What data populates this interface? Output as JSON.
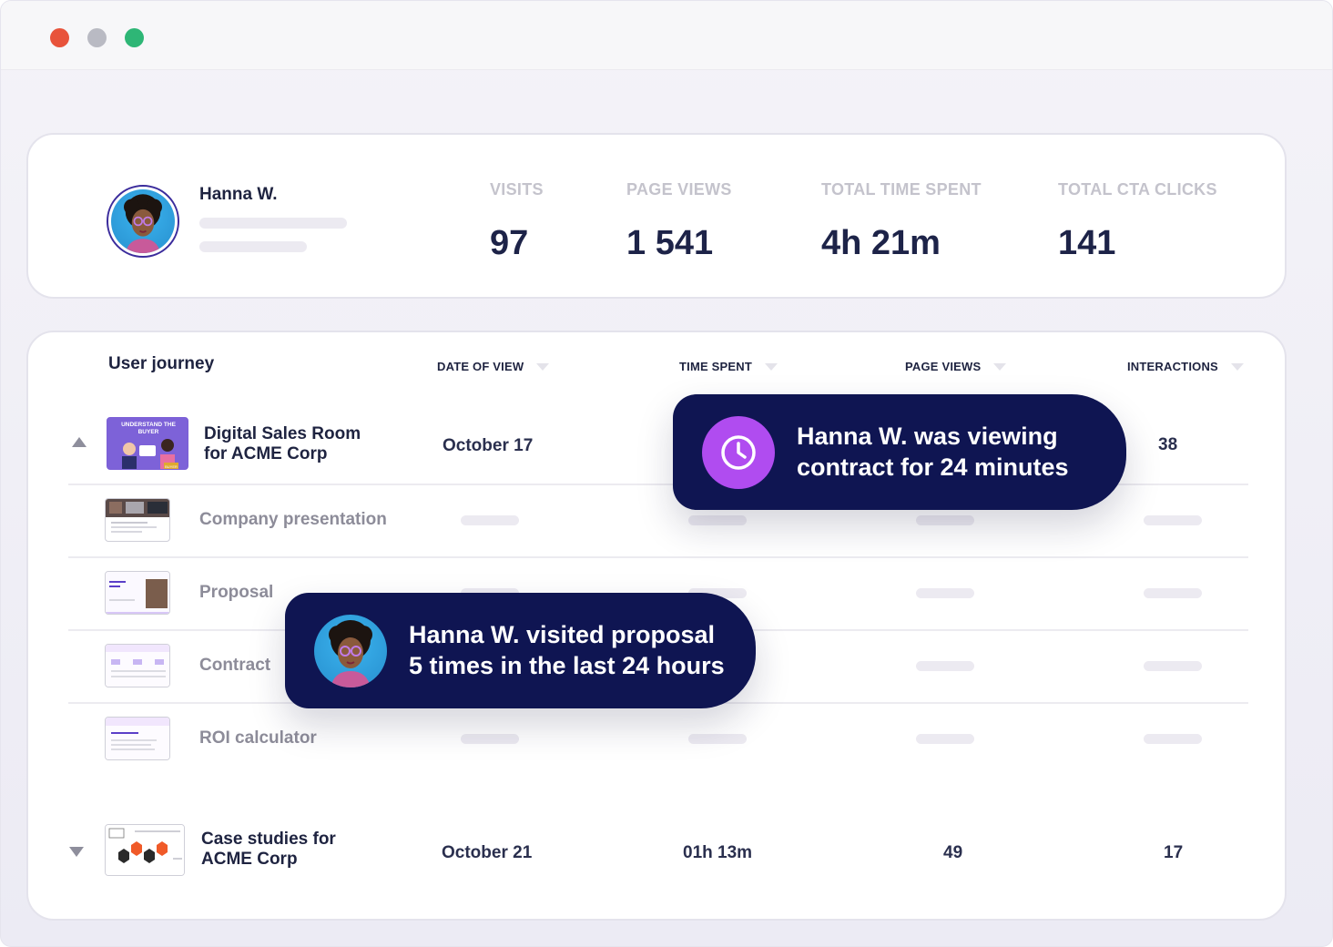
{
  "profile": {
    "name": "Hanna W.",
    "stats": [
      {
        "label": "VISITS",
        "value": "97"
      },
      {
        "label": "PAGE VIEWS",
        "value": "1 541"
      },
      {
        "label": "TOTAL TIME SPENT",
        "value": "4h 21m"
      },
      {
        "label": "TOTAL CTA CLICKS",
        "value": "141"
      }
    ]
  },
  "journey": {
    "title": "User journey",
    "columns": [
      "DATE OF VIEW",
      "TIME SPENT",
      "PAGE VIEWS",
      "INTERACTIONS"
    ],
    "rows": [
      {
        "title_line1": "Digital Sales Room",
        "title_line2": "for ACME Corp",
        "date": "October 17",
        "interactions": "38",
        "thumb_text_1": "UNDERSTAND THE",
        "thumb_text_2": "BUYER",
        "thumb_badge": "BUYER"
      },
      {
        "title": "Company presentation"
      },
      {
        "title": "Proposal"
      },
      {
        "title": "Contract"
      },
      {
        "title": "ROI calculator"
      },
      {
        "title_line1": "Case studies for",
        "title_line2": "ACME Corp",
        "date": "October 21",
        "time_spent": "01h 13m",
        "page_views": "49",
        "interactions": "17"
      }
    ]
  },
  "tooltips": {
    "viewing": {
      "line1": "Hanna W. was viewing",
      "line2": "contract for 24 minutes",
      "icon": "clock-icon"
    },
    "visited": {
      "line1": "Hanna W. visited proposal",
      "line2": "5 times in the last 24 hours"
    }
  },
  "colors": {
    "navy": "#0f1552",
    "purple_accent": "#b04cf0",
    "window_dot_red": "#e8533b",
    "window_dot_gray": "#b9bac3",
    "window_dot_green": "#2eb676"
  }
}
